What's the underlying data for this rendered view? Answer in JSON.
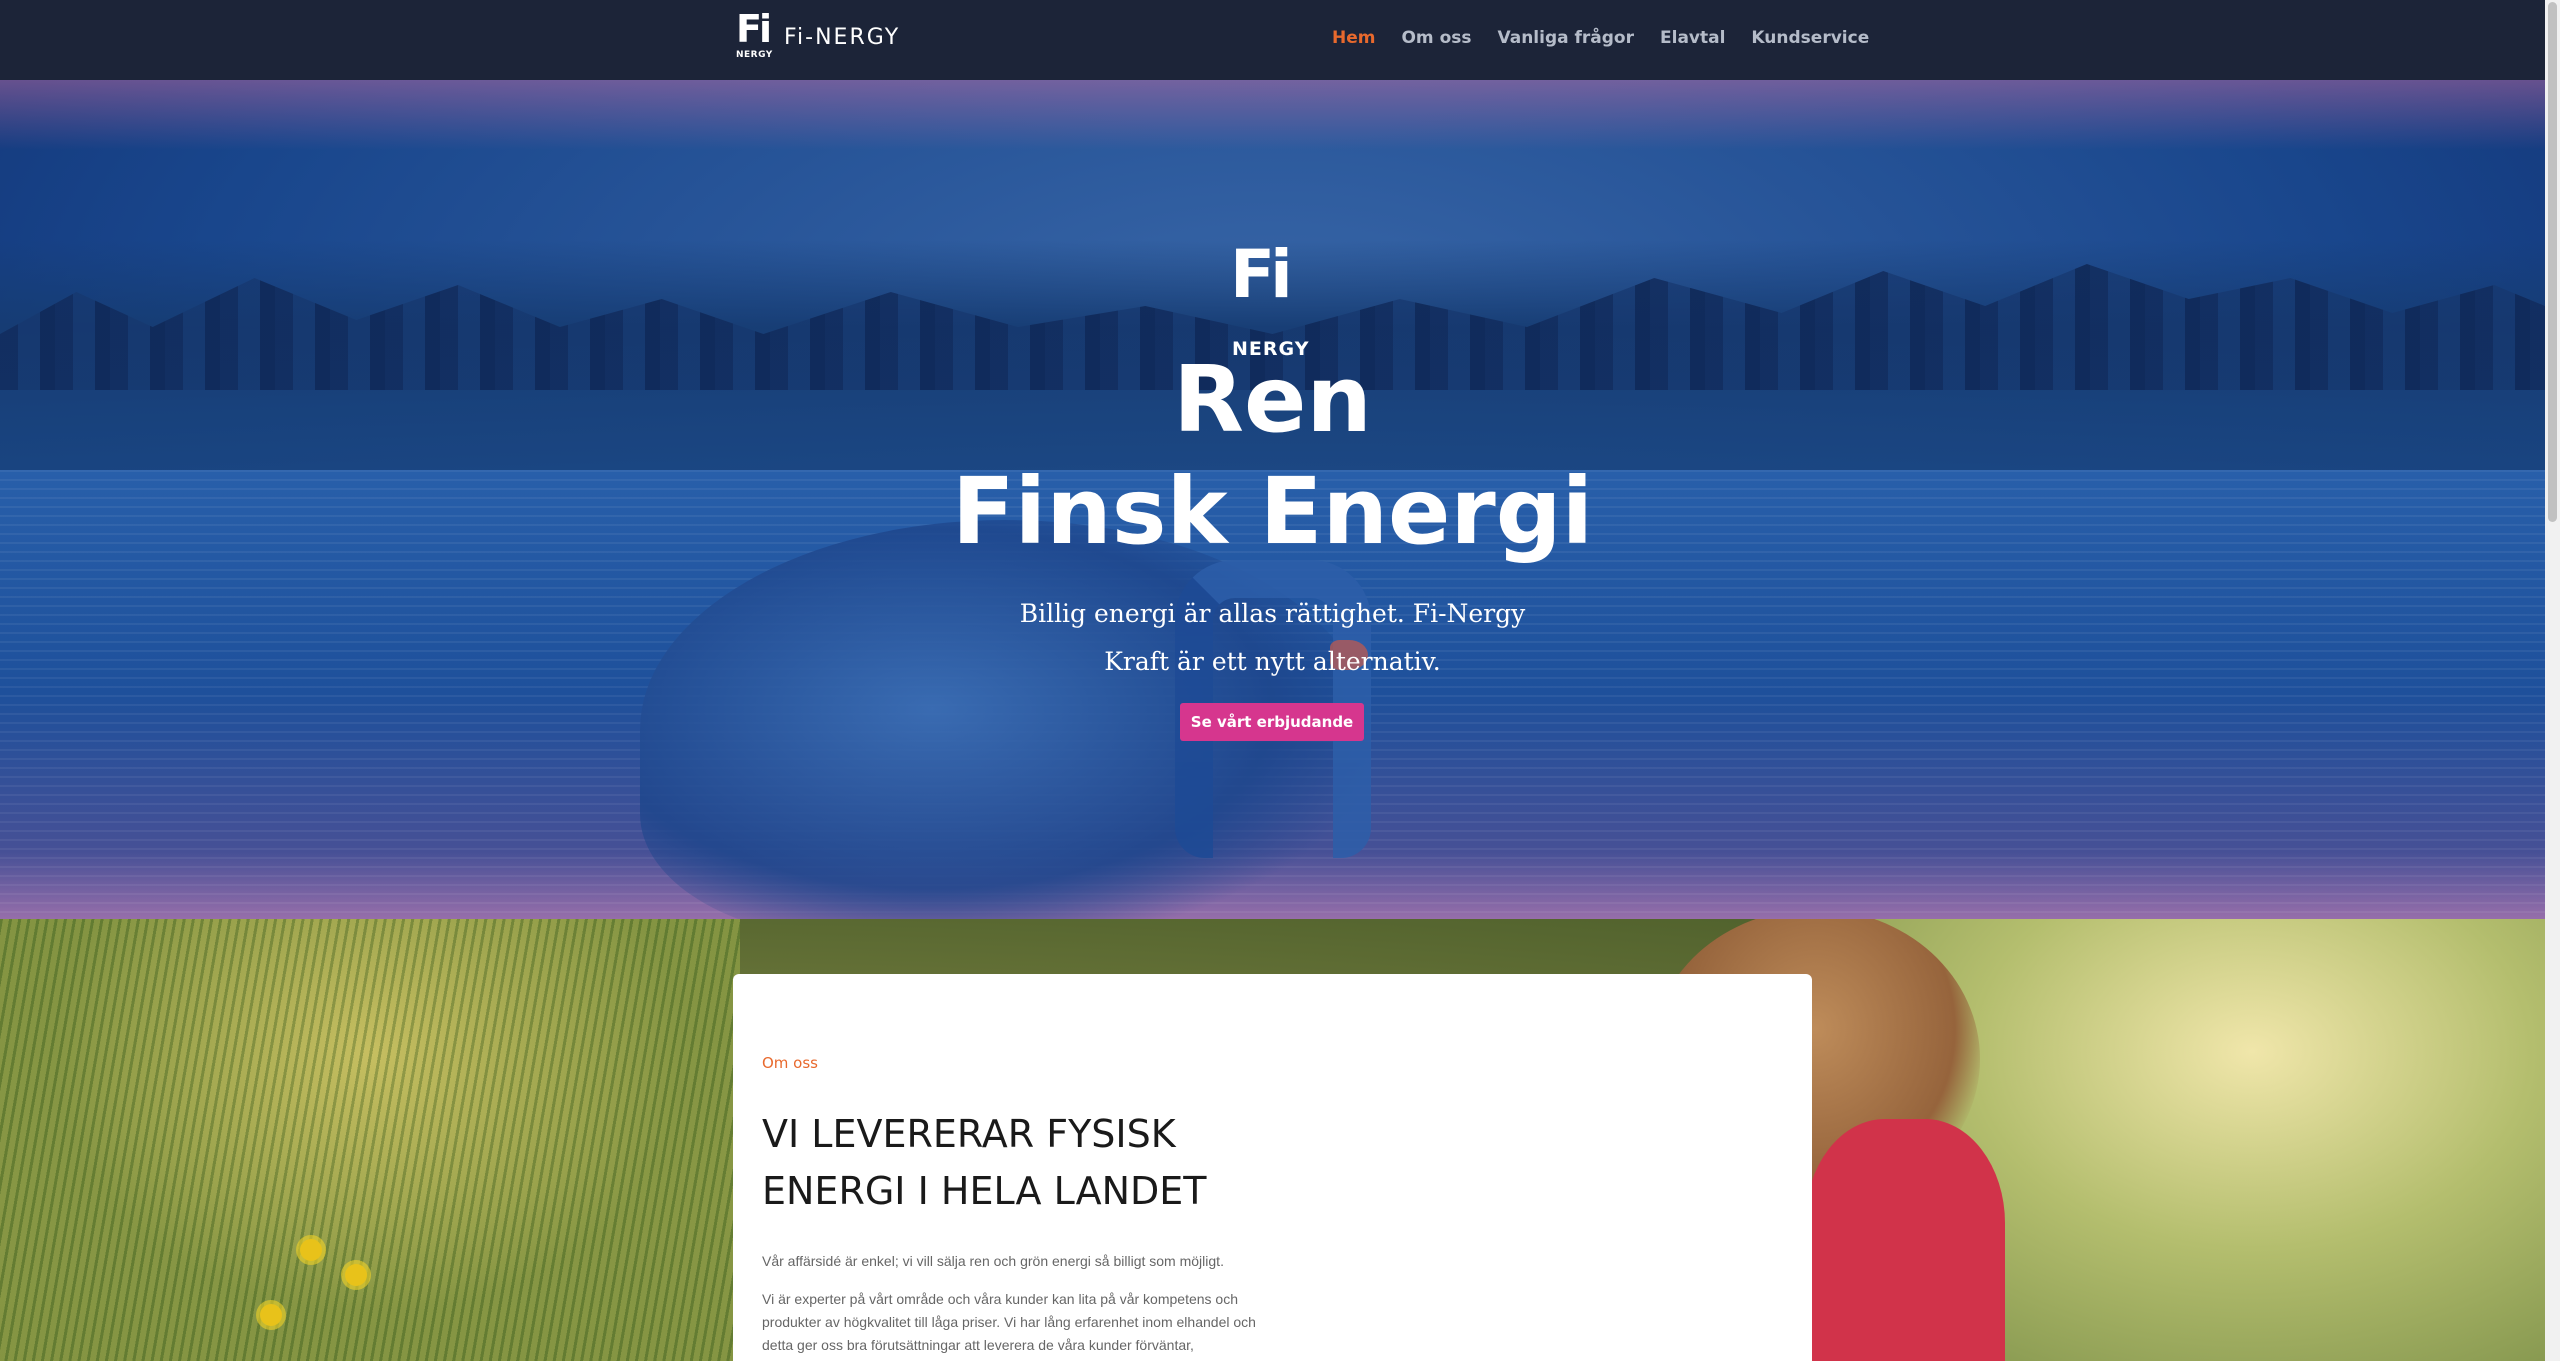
{
  "header": {
    "logo_mark": "Fi",
    "logo_sub": "NERGY",
    "brand_name": "Fi-NERGY",
    "nav": [
      {
        "label": "Hem",
        "active": true
      },
      {
        "label": "Om oss",
        "active": false
      },
      {
        "label": "Vanliga frågor",
        "active": false
      },
      {
        "label": "Elavtal",
        "active": false
      },
      {
        "label": "Kundservice",
        "active": false
      }
    ]
  },
  "hero": {
    "logo_mark": "Fi",
    "logo_sub": "NERGY",
    "title_line1": "Ren",
    "title_line2": "Finsk Energi",
    "subtitle_line1": "Billig energi är allas rättighet. Fi-Nergy",
    "subtitle_line2": "Kraft är ett nytt alternativ.",
    "cta_label": "Se vårt erbjudande"
  },
  "about": {
    "tag": "Om oss",
    "heading": "VI LEVERERAR FYSISK ENERGI I HELA LANDET",
    "paragraph1": "Vår affärsidé är enkel; vi vill sälja ren och grön energi så billigt som möjligt.",
    "paragraph2": "Vi är experter på vårt område och våra kunder kan lita på vår kompetens och produkter av högkvalitet till låga priser. Vi har lång erfarenhet inom elhandel och detta ger oss bra förutsättningar att leverera de våra kunder förväntar,"
  },
  "colors": {
    "header_bg": "#1c2438",
    "nav_active": "#e8692d",
    "nav_inactive": "#b5bcc9",
    "cta_bg": "#d6368e",
    "tag_color": "#e8692d"
  }
}
